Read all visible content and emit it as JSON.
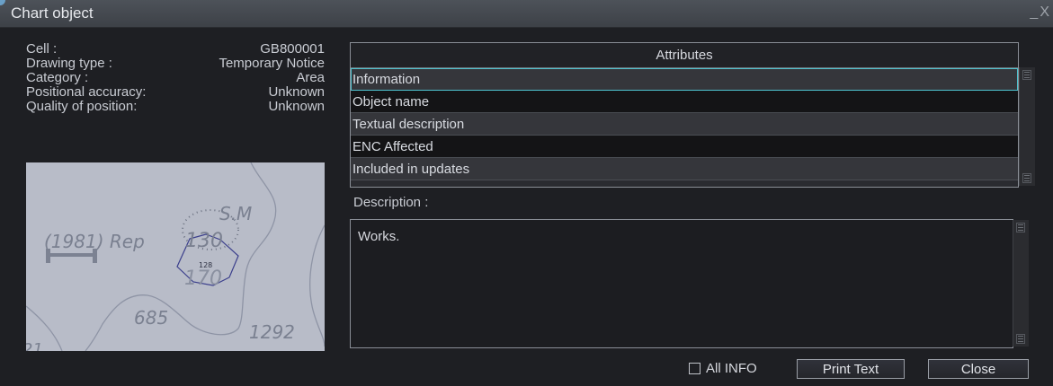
{
  "window": {
    "title": "Chart object",
    "controls": "_X"
  },
  "info": [
    {
      "label": "Cell :",
      "value": "GB800001"
    },
    {
      "label": "Drawing type :",
      "value": "Temporary Notice"
    },
    {
      "label": "Category :",
      "value": "Area"
    },
    {
      "label": "Positional accuracy:",
      "value": "Unknown"
    },
    {
      "label": "Quality of position:",
      "value": "Unknown"
    }
  ],
  "map": {
    "labels": [
      "S.M",
      "(1981) Rep",
      "130",
      "128",
      "170",
      "685",
      "1292",
      "21"
    ]
  },
  "attributes": {
    "header": "Attributes",
    "rows": [
      "Information",
      "Object name",
      "Textual description",
      "ENC Affected",
      "Included in updates"
    ]
  },
  "description": {
    "label": "Description :",
    "text": "Works."
  },
  "footer": {
    "all_info_label": "All INFO",
    "print_label": "Print Text",
    "close_label": "Close"
  }
}
